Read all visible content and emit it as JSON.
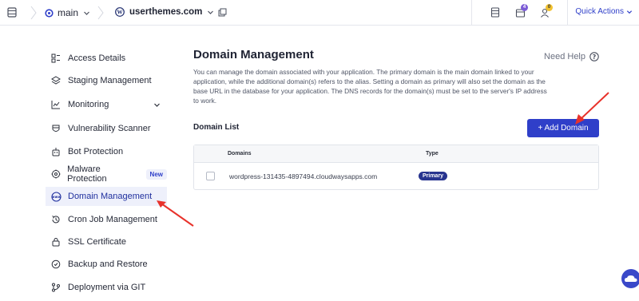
{
  "topbar": {
    "server_name": "main",
    "app_name": "userthemes.com",
    "notifications_count": "4",
    "user_count": "0",
    "quick_actions_label": "Quick Actions",
    "icons": [
      "server-icon",
      "cloudways-icon",
      "wordpress-icon",
      "external-link-icon",
      "document-icon",
      "bell-icon",
      "user-icon"
    ]
  },
  "sidebar": {
    "items": [
      {
        "label": "Access Details",
        "icon": "access-details-icon"
      },
      {
        "label": "Staging Management",
        "icon": "layers-icon"
      },
      {
        "label": "Monitoring",
        "icon": "chart-icon"
      },
      {
        "label": "Vulnerability Scanner",
        "icon": "scanner-icon"
      },
      {
        "label": "Bot Protection",
        "icon": "bot-icon"
      },
      {
        "label": "Malware Protection",
        "icon": "malware-icon",
        "badge": "New"
      },
      {
        "label": "Domain Management",
        "icon": "www-icon",
        "active": true
      },
      {
        "label": "Cron Job Management",
        "icon": "history-icon"
      },
      {
        "label": "SSL Certificate",
        "icon": "lock-icon"
      },
      {
        "label": "Backup and Restore",
        "icon": "backup-icon"
      },
      {
        "label": "Deployment via GIT",
        "icon": "git-icon"
      }
    ]
  },
  "main": {
    "title": "Domain Management",
    "help_label": "Need Help",
    "description": "You can manage the domain associated with your application. The primary domain is the main domain linked to your application, while the additional domain(s) refers to the alias. Setting a domain as primary will also set the domain as the base URL in the database for your application. The DNS records for the domain(s) must be set to the server's IP address to work.",
    "list_title": "Domain List",
    "add_button_label": "+ Add Domain",
    "table": {
      "columns": [
        "Domains",
        "Type"
      ],
      "rows": [
        {
          "domain": "wordpress-131435-4897494.cloudwaysapps.com",
          "type": "Primary"
        }
      ]
    }
  },
  "colors": {
    "accent": "#2f3fc9",
    "primary_badge": "#27348f",
    "annotation_arrow": "#e8322b"
  }
}
